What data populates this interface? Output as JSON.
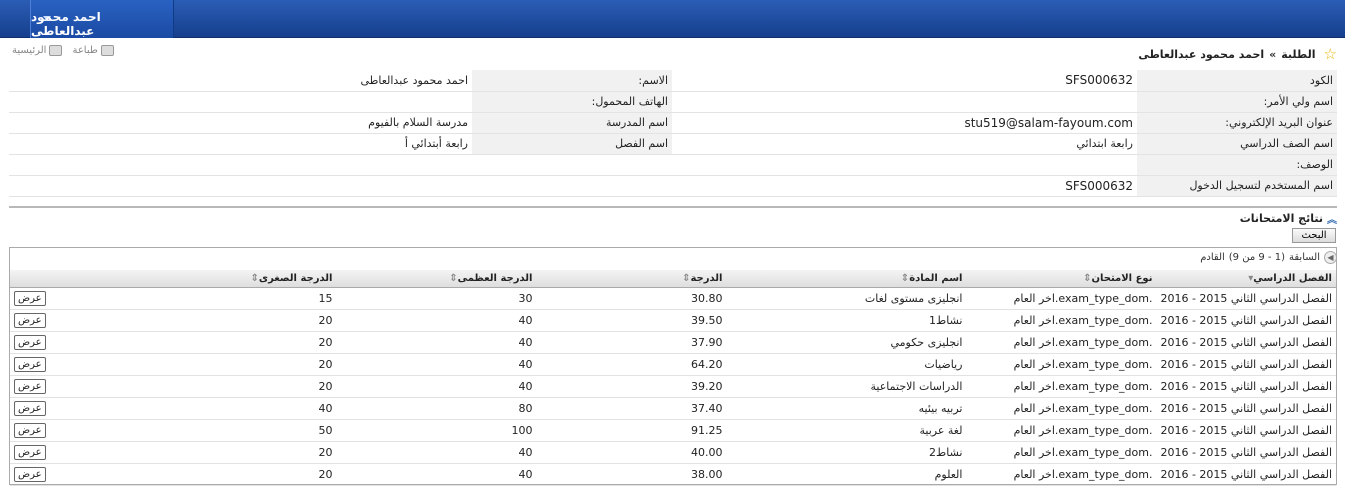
{
  "header": {
    "user_name": "احمد محمود عبدالعاطى"
  },
  "breadcrumb": {
    "root": "الطلبة",
    "separator": "»",
    "current": "احمد محمود عبدالعاطى"
  },
  "toolbar": {
    "home_label": "الرئيسية",
    "print_label": "طباعة"
  },
  "info": {
    "code_label": "الكود",
    "code_value": "SFS000632",
    "name_label": "الاسم:",
    "name_value": "احمد محمود عبدالعاطى",
    "guardian_label": "اسم ولي الأمر:",
    "guardian_value": "",
    "mobile_label": "الهاتف المحمول:",
    "mobile_value": "",
    "email_label": "عنوان البريد الإلكتروني:",
    "email_value": "stu519@salam-fayoum.com",
    "school_label": "اسم المدرسة",
    "school_value": "مدرسة السلام بالفيوم",
    "grade_label": "اسم الصف الدراسي",
    "grade_value": "رابعة ابتدائي",
    "class_label": "اسم الفصل",
    "class_value": "رابعة أبتدائي أ",
    "desc_label": "الوصف:",
    "desc_value": "",
    "username_label": "اسم المستخدم لتسجيل الدخول",
    "username_value": "SFS000632"
  },
  "section": {
    "title": "نتائج الامتحانات",
    "search_button": "البحث"
  },
  "pager": {
    "previous": "السابقة",
    "range": "(1 - 9 من 9)",
    "next": "القادم"
  },
  "table": {
    "columns": [
      "الفصل الدراسي",
      "نوع الامتحان",
      "اسم المادة",
      "الدرجة",
      "الدرجة العظمى",
      "الدرجة الصغرى"
    ],
    "view_label": "عرض",
    "rows": [
      [
        "الفصل الدراسي الثاني 2015 - 2016",
        ".exam_type_dom.اخر العام",
        "انجليزى مستوى لغات",
        "30.80",
        "30",
        "15"
      ],
      [
        "الفصل الدراسي الثاني 2015 - 2016",
        ".exam_type_dom.اخر العام",
        "نشاط1",
        "39.50",
        "40",
        "20"
      ],
      [
        "الفصل الدراسي الثاني 2015 - 2016",
        ".exam_type_dom.اخر العام",
        "انجليزى حكومي",
        "37.90",
        "40",
        "20"
      ],
      [
        "الفصل الدراسي الثاني 2015 - 2016",
        ".exam_type_dom.اخر العام",
        "رياضيات",
        "64.20",
        "40",
        "20"
      ],
      [
        "الفصل الدراسي الثاني 2015 - 2016",
        ".exam_type_dom.اخر العام",
        "الدراسات الاجتماعية",
        "39.20",
        "40",
        "20"
      ],
      [
        "الفصل الدراسي الثاني 2015 - 2016",
        ".exam_type_dom.اخر العام",
        "تربيه بيئيه",
        "37.40",
        "80",
        "40"
      ],
      [
        "الفصل الدراسي الثاني 2015 - 2016",
        ".exam_type_dom.اخر العام",
        "لغة عربية",
        "91.25",
        "100",
        "50"
      ],
      [
        "الفصل الدراسي الثاني 2015 - 2016",
        ".exam_type_dom.اخر العام",
        "نشاط2",
        "40.00",
        "40",
        "20"
      ],
      [
        "الفصل الدراسي الثاني 2015 - 2016",
        ".exam_type_dom.اخر العام",
        "العلوم",
        "38.00",
        "40",
        "20"
      ]
    ]
  },
  "icons": [
    "star-icon",
    "print-icon",
    "home-icon",
    "sort-icon",
    "collapse-icon",
    "prev-page-icon"
  ]
}
